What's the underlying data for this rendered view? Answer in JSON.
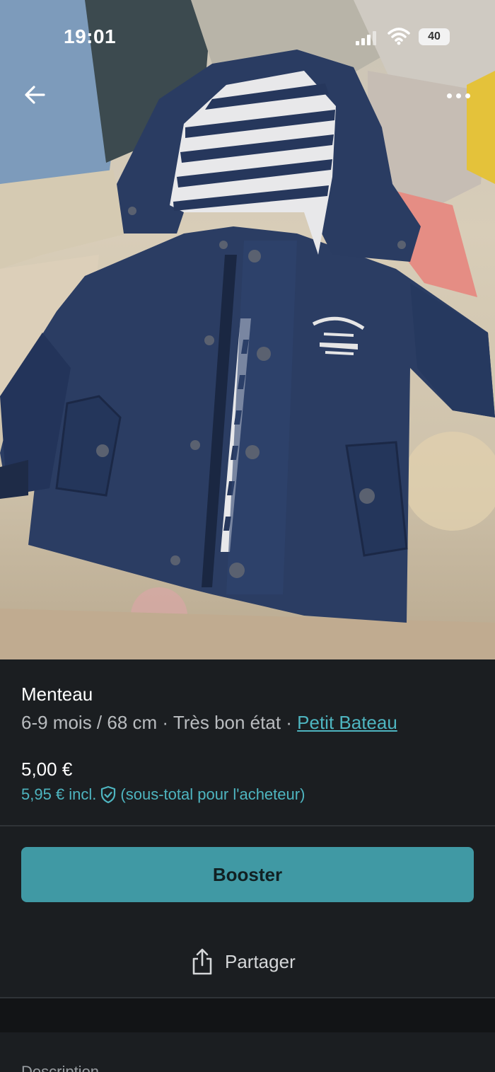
{
  "status_bar": {
    "time": "19:01",
    "battery": "40"
  },
  "nav": {
    "back_icon": "arrow-left-icon",
    "more_icon": "more-dots-icon"
  },
  "listing": {
    "title": "Menteau",
    "size": "6-9 mois / 68 cm",
    "separator": " · ",
    "condition": "Très bon état",
    "brand": "Petit Bateau",
    "price": "5,00 €",
    "price_incl": "5,95 € incl.",
    "price_incl_note": "(sous-total pour l'acheteur)"
  },
  "actions": {
    "booster_label": "Booster",
    "share_label": "Partager"
  },
  "section": {
    "description_label": "Description"
  },
  "colors": {
    "background": "#1b1e21",
    "accent": "#4eb5c0",
    "button": "#4099a4"
  }
}
